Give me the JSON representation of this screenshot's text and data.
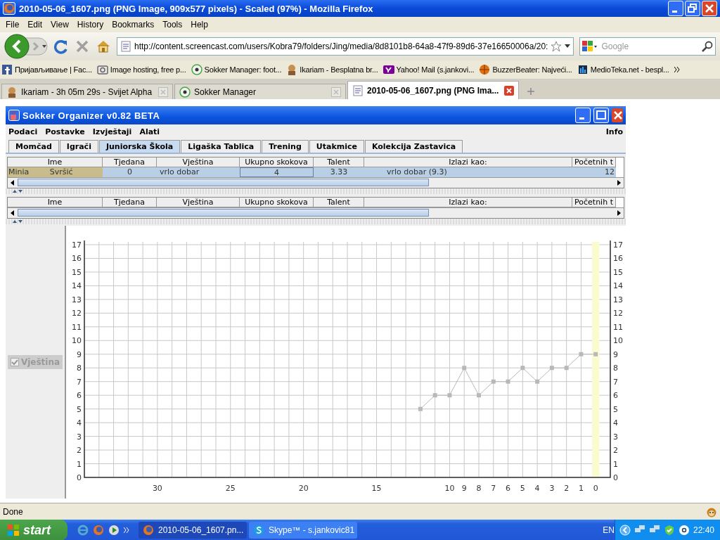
{
  "browser": {
    "title": "2010-05-06_1607.png (PNG Image, 909x577 pixels) - Scaled (97%) - Mozilla Firefox",
    "menu": [
      "File",
      "Edit",
      "View",
      "History",
      "Bookmarks",
      "Tools",
      "Help"
    ],
    "url": "http://content.screencast.com/users/Kobra79/folders/Jing/media/8d8101b8-64a8-47f9-89d6-37e16650006a/20:",
    "search": {
      "placeholder": "Google"
    },
    "bookmarks": [
      "Пријављивање | Fac...",
      "Image hosting, free p...",
      "Sokker Manager: foot...",
      "Ikariam - Besplatna br...",
      "Yahoo! Mail (s.jankovi...",
      "BuzzerBeater: Najveći...",
      "MedioTeka.net - bespl..."
    ],
    "tabs": [
      {
        "label": "Ikariam - 3h 05m 29s - Svijet Alpha",
        "selected": false
      },
      {
        "label": "Sokker Manager",
        "selected": false
      },
      {
        "label": "2010-05-06_1607.png (PNG Ima...",
        "selected": true
      }
    ],
    "status": "Done"
  },
  "app": {
    "title": "Sokker Organizer v0.82 BETA",
    "menu": [
      "Podaci",
      "Postavke",
      "Izvještaji",
      "Alati"
    ],
    "menu_right": "Info",
    "tabs": [
      {
        "label": "Momčad",
        "selected": false
      },
      {
        "label": "Igrači",
        "selected": false
      },
      {
        "label": "Juniorska Škola",
        "selected": true
      },
      {
        "label": "Ligaška Tablica",
        "selected": false
      },
      {
        "label": "Trening",
        "selected": false
      },
      {
        "label": "Utakmice",
        "selected": false
      },
      {
        "label": "Kolekcija Zastavica",
        "selected": false
      }
    ],
    "table_1": {
      "columns": [
        "Ime",
        "Tjedana",
        "Vještina",
        "Ukupno skokova",
        "Talent",
        "Izlazi kao:",
        "Početnih t"
      ],
      "rows": [
        {
          "cells": [
            "Minia Svršić",
            "0",
            "vrlo dobar",
            "4",
            "3.33",
            "vrlo dobar (9.3)",
            "12"
          ],
          "selected": true
        }
      ]
    },
    "table_2": {
      "columns": [
        "Ime",
        "Tjedana",
        "Vještina",
        "Ukupno skokova",
        "Talent",
        "Izlazi kao:",
        "Početnih t"
      ]
    },
    "series_toggle": {
      "checked": true,
      "disabled": true
    },
    "left_axis_labels": [
      "17",
      "16",
      "15",
      "14",
      "13",
      "12",
      "11",
      "10",
      "9",
      "8",
      "7",
      "6",
      "5",
      "4",
      "3",
      "2",
      "1",
      "0"
    ],
    "chart_data": {
      "type": "line",
      "grid": true,
      "xlim": [
        35,
        -1
      ],
      "ylim": [
        0,
        17
      ],
      "bands": [
        {
          "axis": "x",
          "from": -0.25,
          "to": 0.25,
          "color": "#fbfbd0"
        }
      ],
      "xticks": [
        30,
        25,
        20,
        15,
        10,
        9,
        8,
        7,
        6,
        5,
        4,
        3,
        2,
        1,
        0
      ],
      "yticks": [
        0,
        1,
        2,
        3,
        4,
        5,
        6,
        7,
        8,
        9,
        10,
        11,
        12,
        13,
        14,
        15,
        16,
        17
      ],
      "x": [
        12,
        11,
        10,
        9,
        8,
        7,
        6,
        5,
        4,
        3,
        2,
        1,
        0
      ],
      "series": [
        {
          "name": "Vještina",
          "color": "#b8b8b8",
          "marker": "square",
          "values": [
            5,
            6,
            6,
            8,
            6,
            7,
            7,
            8,
            7,
            8,
            8,
            9,
            9
          ]
        }
      ]
    }
  },
  "taskbar": {
    "start": "start",
    "tasks": [
      {
        "label": "2010-05-06_1607.pn...",
        "selected": true
      },
      {
        "label": "Skype™ - s.jankovic81",
        "selected": false
      }
    ],
    "language": "EN",
    "clock": "22:40"
  }
}
